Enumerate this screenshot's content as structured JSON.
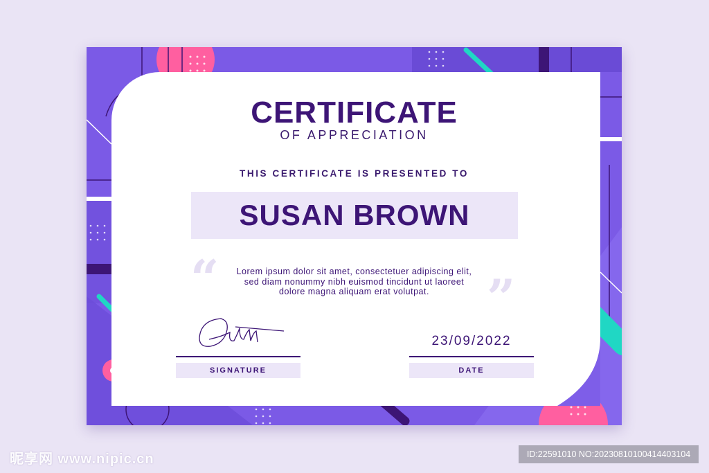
{
  "certificate": {
    "title": "CERTIFICATE",
    "subtitle": "OF APPRECIATION",
    "presented_to": "THIS CERTIFICATE IS PRESENTED TO",
    "recipient_name": "SUSAN BROWN",
    "body_lines": [
      "Lorem ipsum dolor sit amet, consectetuer adipiscing elit,",
      "sed diam nonummy nibh euismod tincidunt ut laoreet",
      "dolore magna aliquam erat volutpat."
    ],
    "signature_label": "SIGNATURE",
    "date_value": "23/09/2022",
    "date_label": "DATE"
  },
  "watermarks": {
    "left": "昵享网 www.nipic.cn",
    "right": "ID:22591010 NO:20230810100414403104"
  },
  "colors": {
    "page_background": "#eae4f5",
    "frame_purple": "#7e5ee8",
    "dark_purple": "#3d1576",
    "accent_pink": "#ff5fa0",
    "accent_teal": "#20d7c4",
    "light_lavender": "#ece6f8"
  },
  "icons": [
    "open-quote-icon",
    "close-quote-icon",
    "signature-icon"
  ]
}
